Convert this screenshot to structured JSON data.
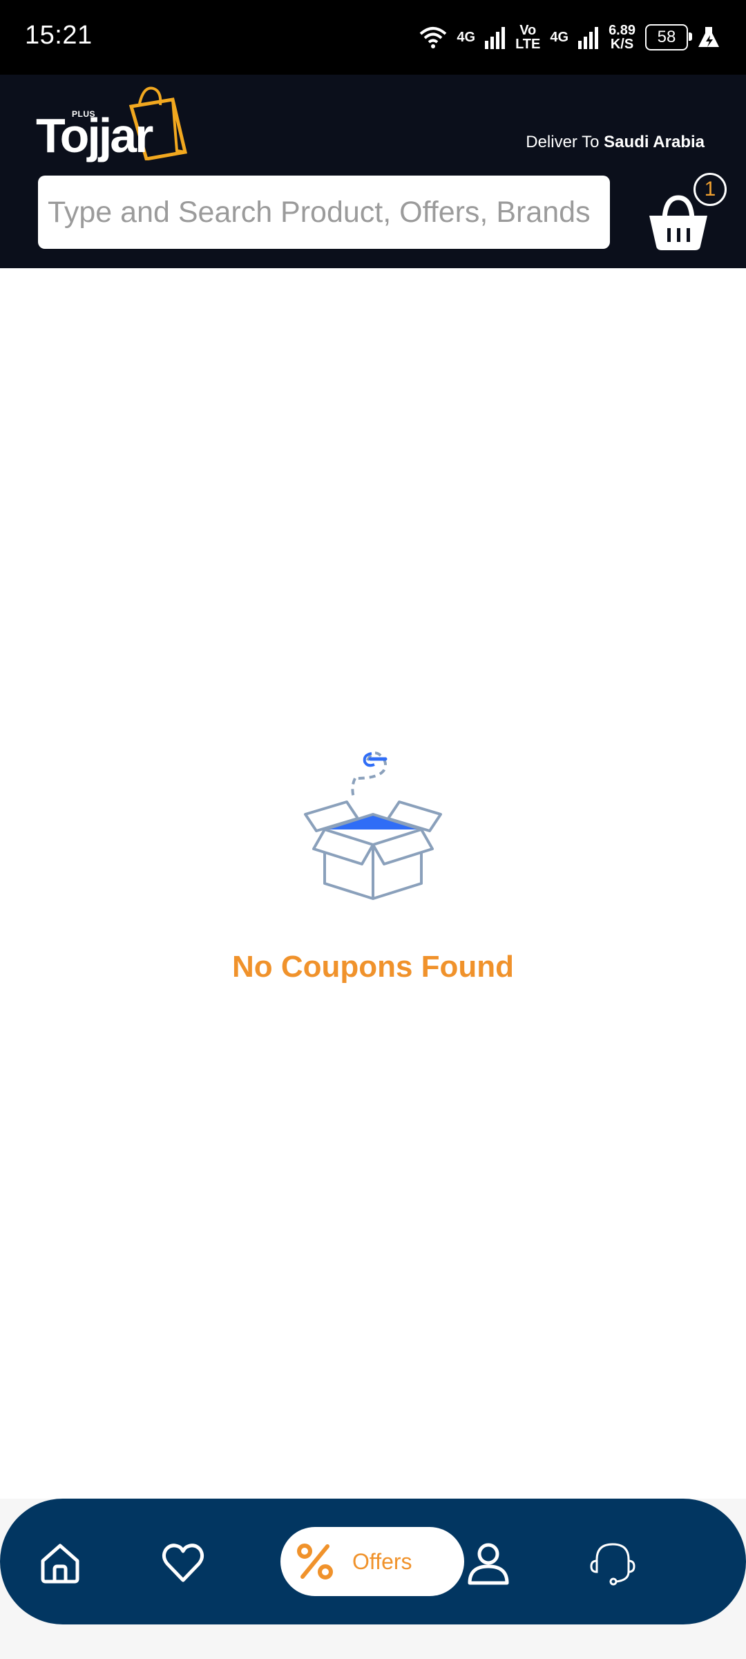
{
  "status_bar": {
    "time": "15:21",
    "net1": "4G",
    "volte_top": "Vo",
    "volte_bottom": "LTE",
    "net2": "4G",
    "speed_value": "6.89",
    "speed_unit": "K/S",
    "battery": "58"
  },
  "header": {
    "logo_plus": "PLUS",
    "logo_text": "Tojjar",
    "deliver_prefix": "Deliver To ",
    "deliver_country": "Saudi Arabia",
    "search_placeholder": "Type and Search Product, Offers, Brands",
    "cart_count": "1"
  },
  "main": {
    "empty_message": "No Coupons Found"
  },
  "bottom_nav": {
    "items": [
      {
        "icon": "home-icon"
      },
      {
        "icon": "heart-icon"
      },
      {
        "icon": "percent-icon",
        "label": "Offers",
        "active": true
      },
      {
        "icon": "user-icon"
      },
      {
        "icon": "headset-icon"
      }
    ]
  },
  "colors": {
    "header_bg": "#0b0f1b",
    "nav_bg": "#023661",
    "accent": "#f0922b",
    "box_blue": "#2f6df6"
  }
}
